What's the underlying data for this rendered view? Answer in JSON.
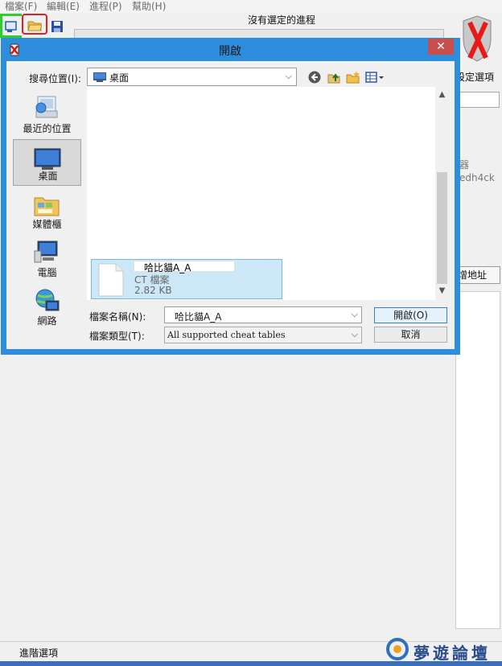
{
  "menubar": {
    "items": [
      "檔案(F)",
      "編輯(E)",
      "進程(P)",
      "幫助(H)"
    ]
  },
  "main": {
    "process_title": "沒有選定的進程",
    "settings_label": "設定選項",
    "right_text_1": "器",
    "right_text_2": "edh4ck",
    "add_address": "增地址",
    "advanced_options": "進階選項"
  },
  "watermark": {
    "text": "夢遊論壇"
  },
  "dialog": {
    "title": "開啟",
    "close_glyph": "✕",
    "look_in_label": "搜尋位置(I):",
    "look_in_value": "桌面",
    "places": [
      {
        "label": "最近的位置",
        "icon": "recent-places-icon"
      },
      {
        "label": "桌面",
        "icon": "desktop-icon"
      },
      {
        "label": "媒體櫃",
        "icon": "libraries-icon"
      },
      {
        "label": "電腦",
        "icon": "computer-icon"
      },
      {
        "label": "網路",
        "icon": "network-icon"
      }
    ],
    "file": {
      "name": "哈比貓A_A",
      "type": "CT 檔案",
      "size": "2.82 KB"
    },
    "filename_label": "檔案名稱(N):",
    "filename_value": "哈比貓A_A",
    "filetype_label": "檔案類型(T):",
    "filetype_value": "All supported cheat tables",
    "open_button": "開啟(O)",
    "cancel_button": "取消"
  },
  "colors": {
    "dialog_border": "#2e8ddc",
    "close_button": "#c94f4f",
    "selection": "#cce8f7",
    "highlight_red": "#e02020",
    "highlight_green": "#2bd02b"
  }
}
